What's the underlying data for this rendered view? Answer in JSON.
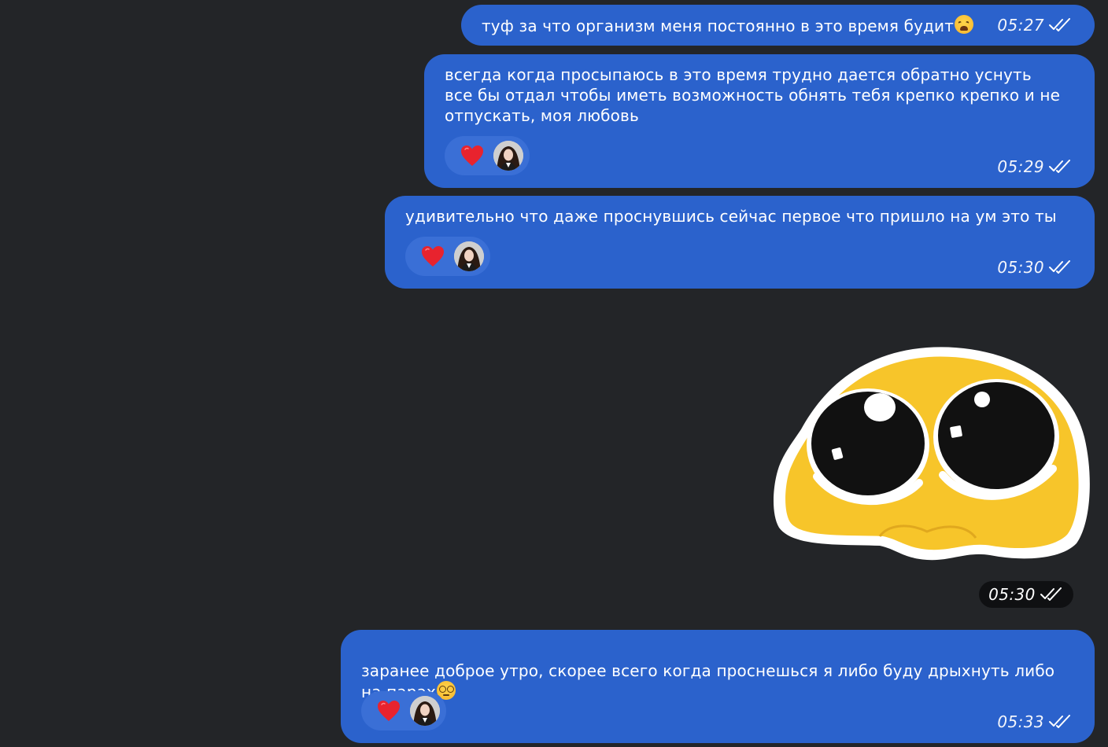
{
  "messages": [
    {
      "text": "туф за что организм меня постоянно в это время будит",
      "emoji": "weary-face-emoji",
      "time": "05:27"
    },
    {
      "text": "всегда когда просыпаюсь в это время трудно дается обратно уснуть\nвсе бы отдал чтобы иметь возможность обнять тебя крепко крепко и не\nотпускать, моя любовь",
      "time": "05:29",
      "reaction": "red-heart"
    },
    {
      "text": "удивительно что даже проснувшись сейчас первое что пришло на ум это ты",
      "time": "05:30",
      "reaction": "red-heart"
    },
    {
      "sticker": "pleading-yellow-blob-sticker",
      "time": "05:30"
    },
    {
      "text": "заранее доброе утро, скорее всего когда проснешься я либо буду дрыхнуть либо\nна парах",
      "emoji": "dizzy-face-emoji",
      "time": "05:33",
      "reaction": "red-heart"
    }
  ],
  "colors": {
    "background": "#232528",
    "bubble": "#2B62CC",
    "reaction_pill": "#3A6FD6",
    "time_pill": "#0f1012"
  }
}
